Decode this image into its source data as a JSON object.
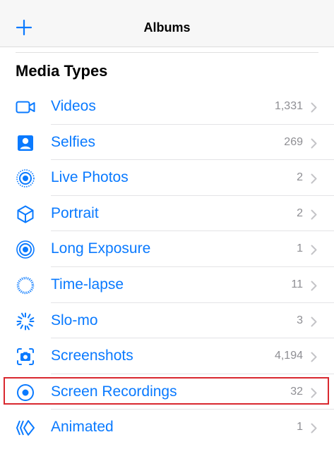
{
  "navbar": {
    "title": "Albums",
    "add_icon": "plus-icon"
  },
  "section": {
    "title": "Media Types"
  },
  "items": [
    {
      "label": "Videos",
      "count": "1,331",
      "icon": "video-icon"
    },
    {
      "label": "Selfies",
      "count": "269",
      "icon": "selfie-icon"
    },
    {
      "label": "Live Photos",
      "count": "2",
      "icon": "live-photos-icon"
    },
    {
      "label": "Portrait",
      "count": "2",
      "icon": "portrait-cube-icon"
    },
    {
      "label": "Long Exposure",
      "count": "1",
      "icon": "long-exposure-icon"
    },
    {
      "label": "Time-lapse",
      "count": "11",
      "icon": "time-lapse-icon"
    },
    {
      "label": "Slo-mo",
      "count": "3",
      "icon": "slo-mo-icon"
    },
    {
      "label": "Screenshots",
      "count": "4,194",
      "icon": "screenshot-icon"
    },
    {
      "label": "Screen Recordings",
      "count": "32",
      "icon": "screen-recording-icon"
    },
    {
      "label": "Animated",
      "count": "1",
      "icon": "animated-icon"
    }
  ],
  "colors": {
    "accent": "#0a7aff",
    "count": "#8e8e93",
    "highlight": "#d9282f"
  }
}
